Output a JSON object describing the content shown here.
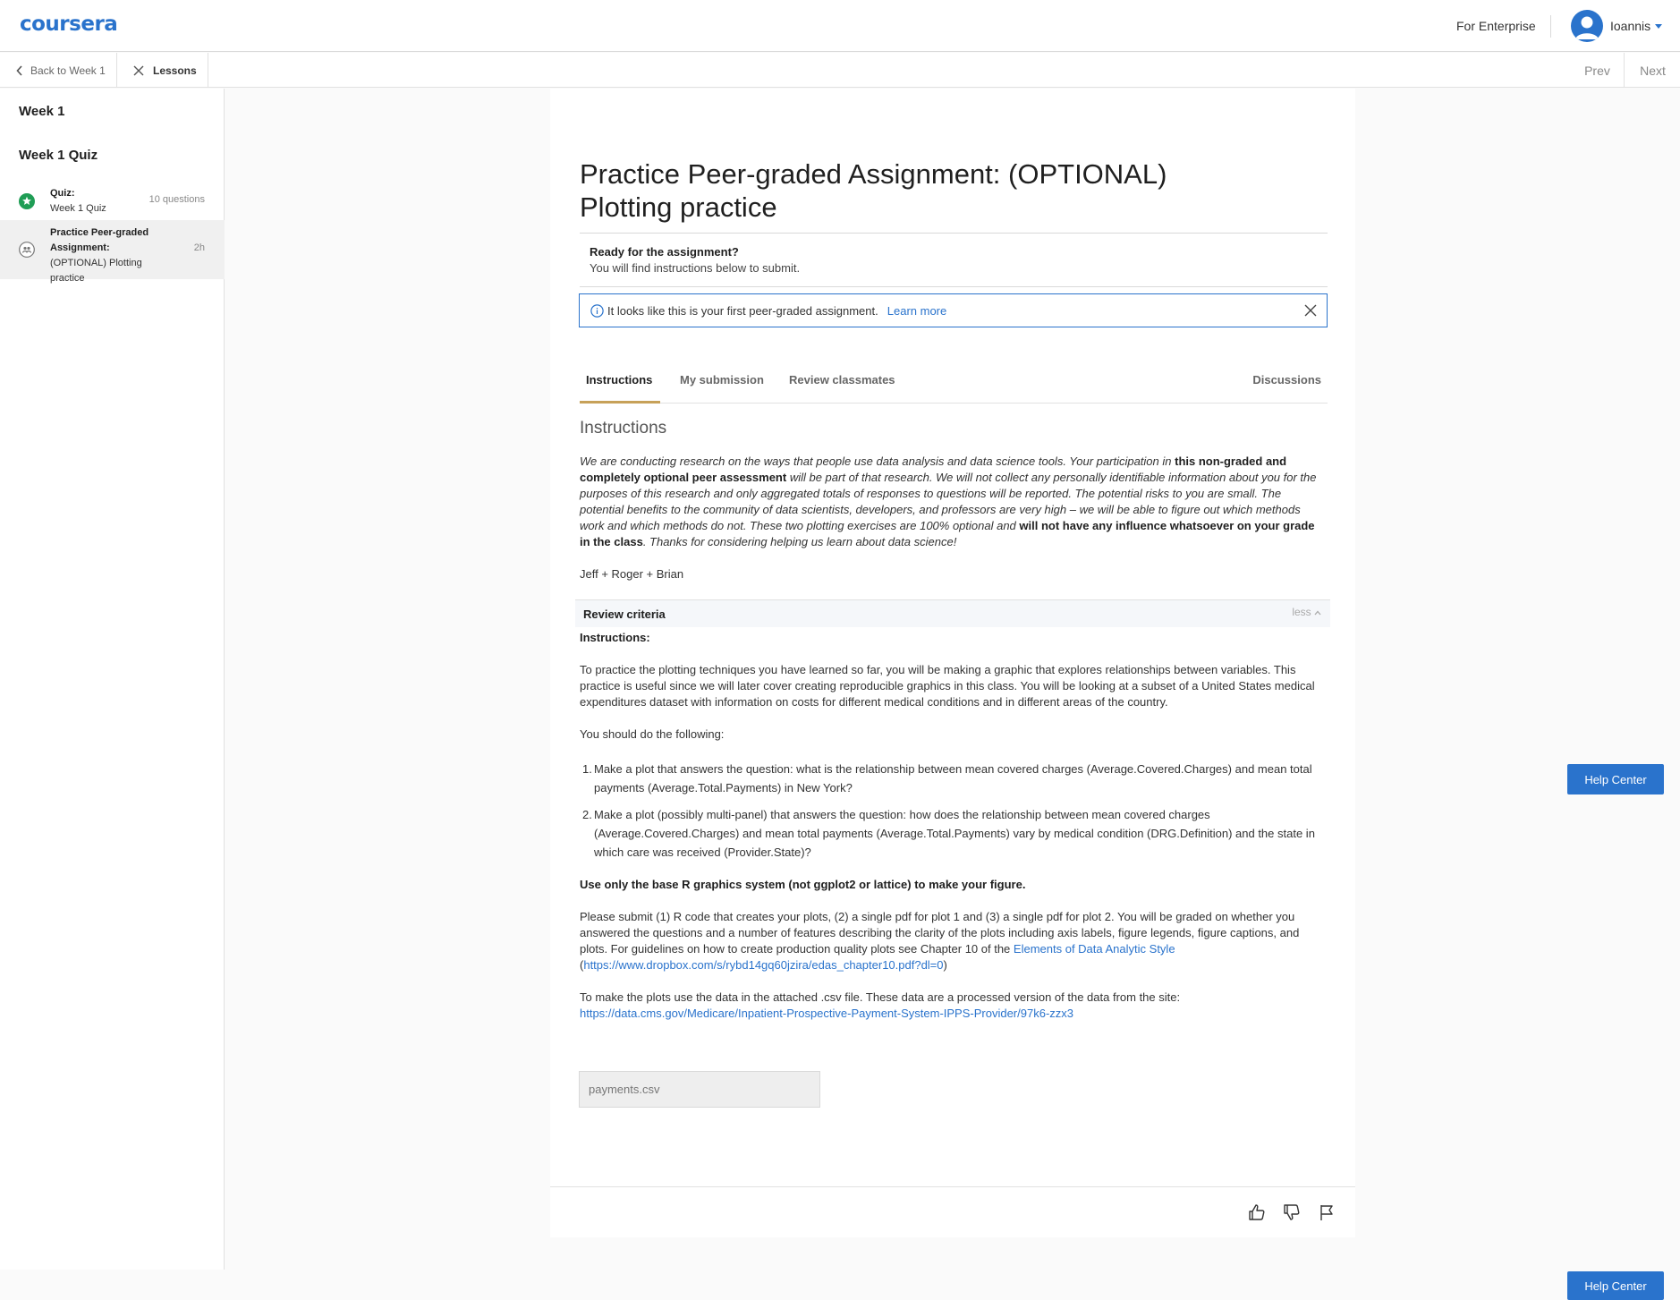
{
  "header": {
    "logo": "coursera",
    "enterprise_link": "For Enterprise",
    "user_name": "Ioannis"
  },
  "subnav": {
    "back_label": "Back to Week 1",
    "lessons_label": "Lessons",
    "prev_label": "Prev",
    "next_label": "Next"
  },
  "sidebar": {
    "week_title": "Week 1",
    "section_title": "Week 1 Quiz",
    "items": [
      {
        "type_label": "Quiz:",
        "title": "Week 1 Quiz",
        "meta": "10 questions",
        "status": "completed"
      },
      {
        "type_label": "Practice Peer-graded Assignment:",
        "title": "(OPTIONAL) Plotting practice",
        "meta": "2h",
        "status": "current"
      }
    ]
  },
  "assignment": {
    "title": "Practice Peer-graded Assignment: (OPTIONAL) Plotting practice",
    "ready_title": "Ready for the assignment?",
    "ready_sub": "You will find instructions below to submit.",
    "notice_text": "It looks like this is your first peer-graded assignment.",
    "notice_link": "Learn more"
  },
  "tabs": {
    "instructions": "Instructions",
    "my_submission": "My submission",
    "review_classmates": "Review classmates",
    "discussions": "Discussions"
  },
  "instructions": {
    "heading": "Instructions",
    "intro_1": "We are conducting research on the ways that people use data analysis and data science tools. Your participation in ",
    "intro_bold_1": "this non-graded and completely optional peer assessment",
    "intro_2": " will be part of that research. We will not collect any personally identifiable information about you for the purposes of this research and only aggregated totals of responses to questions will be reported. The potential risks to you are small. The potential benefits to the community of data scientists, developers, and professors are very high – we will be able to figure out which methods work and which methods do not. These two plotting exercises are 100% optional and ",
    "intro_bold_2": "will not have any influence whatsoever on your grade in the class",
    "intro_3": ". Thanks for considering helping us learn about data science!",
    "signature": "Jeff + Roger + Brian",
    "criteria_title": "Review criteria",
    "criteria_toggle": "less",
    "label": "Instructions:",
    "para_1": "To practice the plotting techniques you have learned so far, you will be making a graphic that explores relationships between variables. This practice is useful since we will later cover creating reproducible graphics in this class. You will be looking at a subset of a United States medical expenditures dataset with information on costs for different medical conditions and in different areas of the country.",
    "para_2": "You should do the following:",
    "list": [
      {
        "num": "1.",
        "text": "Make a plot that answers the question: what is the relationship between mean covered charges (Average.Covered.Charges) and mean total payments (Average.Total.Payments) in New York?"
      },
      {
        "num": "2.",
        "text": "Make a plot (possibly multi-panel) that answers the question: how does the relationship between mean covered charges (Average.Covered.Charges) and mean total payments (Average.Total.Payments) vary by medical condition (DRG.Definition) and the state in which care was received (Provider.State)?"
      }
    ],
    "warning": "Use only the base R graphics system (not ggplot2 or lattice) to make your figure.",
    "para_3_a": "Please submit (1) R code that creates your plots, (2) a single pdf for plot 1 and (3) a single pdf for plot 2. You will be graded on whether you answered the questions and a number of features describing the clarity of the plots including axis labels, figure legends, figure captions, and plots. For guidelines on how to create production quality plots see Chapter 10 of the ",
    "para_3_link": "Elements of Data Analytic Style",
    "para_3_paren_open": "(",
    "para_3_url": "https://www.dropbox.com/s/rybd14gq60jzira/edas_chapter10.pdf?dl=0",
    "para_3_paren_close": ")",
    "para_4": "To make the plots use the data in the attached .csv file. These data are a processed version of the data from the site:",
    "para_4_url": "https://data.cms.gov/Medicare/Inpatient-Prospective-Payment-System-IPPS-Provider/97k6-zzx3",
    "attachment": "payments.csv"
  },
  "help": {
    "label": "Help Center"
  },
  "colors": {
    "brand": "#2a73cc",
    "tab_underline": "#c7a159",
    "complete_green": "#1f9d55"
  },
  "icons": {
    "back": "chevron-left-icon",
    "lessons": "close-icon",
    "info": "info-icon",
    "close": "close-icon",
    "like": "thumbs-up-icon",
    "dislike": "thumbs-down-icon",
    "flag": "flag-icon"
  }
}
